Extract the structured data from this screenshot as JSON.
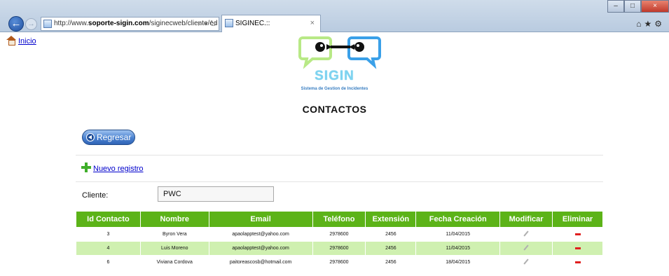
{
  "browser": {
    "url_prefix": "http://www.",
    "url_host": "soporte-sigin.com",
    "url_rest": "/siginecweb/cliente/ed",
    "addr_actions": "⌕ ▾ ↻",
    "tab_title": "SIGINEC.::",
    "tab_close": "×",
    "win_min": "–",
    "win_max": "□",
    "win_close": "×",
    "tool_icons": "⌂★⚙"
  },
  "nav": {
    "home_label": "Inicio"
  },
  "logo": {
    "title": "SIGIN",
    "subtitle": "Sistema de Gestion de Incidentes"
  },
  "page": {
    "title": "CONTACTOS",
    "back_label": "Regresar",
    "new_label": "Nuevo registro",
    "client_label": "Cliente:",
    "client_value": "PWC"
  },
  "table": {
    "headers": [
      "Id Contacto",
      "Nombre",
      "Email",
      "Teléfono",
      "Extensión",
      "Fecha Creación",
      "Modificar",
      "Eliminar"
    ],
    "rows": [
      {
        "id": "3",
        "nombre": "Byron Vera",
        "email": "apaolapptest@yahoo.com",
        "telefono": "2978600",
        "extension": "2456",
        "fecha": "11/04/2015"
      },
      {
        "id": "4",
        "nombre": "Luis Moreno",
        "email": "apaolapptest@yahoo.com",
        "telefono": "2978600",
        "extension": "2456",
        "fecha": "11/04/2015"
      },
      {
        "id": "6",
        "nombre": "Viviana Cordova",
        "email": "paitoreascosb@hotmail.com",
        "telefono": "2978600",
        "extension": "2456",
        "fecha": "18/04/2015"
      }
    ]
  },
  "colors": {
    "header_green": "#5cb318",
    "row_alt": "#cff0b0",
    "logo_green": "#b8e986",
    "logo_blue": "#3aa0e8"
  }
}
